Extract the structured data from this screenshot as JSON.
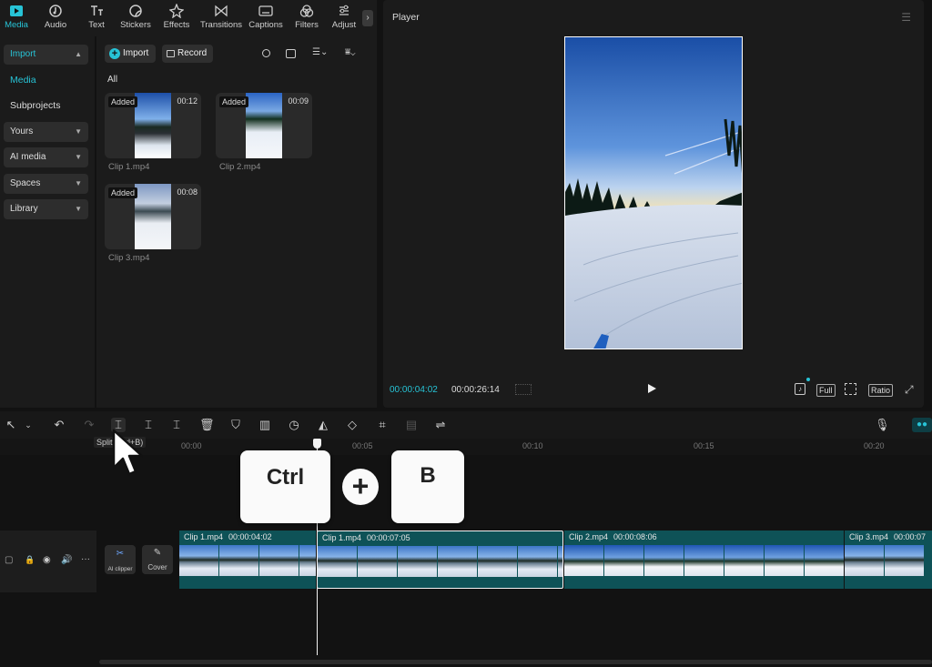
{
  "nav": {
    "tabs": [
      {
        "label": "Media",
        "icon": "media-icon"
      },
      {
        "label": "Audio",
        "icon": "audio-icon"
      },
      {
        "label": "Text",
        "icon": "text-icon"
      },
      {
        "label": "Stickers",
        "icon": "stickers-icon"
      },
      {
        "label": "Effects",
        "icon": "effects-icon"
      },
      {
        "label": "Transitions",
        "icon": "transitions-icon"
      },
      {
        "label": "Captions",
        "icon": "captions-icon"
      },
      {
        "label": "Filters",
        "icon": "filters-icon"
      },
      {
        "label": "Adjust",
        "icon": "adjust-icon"
      }
    ],
    "active": "Media"
  },
  "sidebar": {
    "import_label": "Import",
    "media_label": "Media",
    "subprojects_label": "Subprojects",
    "yours_label": "Yours",
    "ai_media_label": "AI media",
    "spaces_label": "Spaces",
    "library_label": "Library"
  },
  "media": {
    "import_button": "Import",
    "record_button": "Record",
    "filter_label": "All",
    "clips": [
      {
        "name": "Clip 1.mp4",
        "duration": "00:12",
        "badge": "Added"
      },
      {
        "name": "Clip 2.mp4",
        "duration": "00:09",
        "badge": "Added"
      },
      {
        "name": "Clip 3.mp4",
        "duration": "00:08",
        "badge": "Added"
      }
    ]
  },
  "player": {
    "title": "Player",
    "current_time": "00:00:04:02",
    "total_time": "00:00:26:14",
    "full_label": "Full",
    "ratio_label": "Ratio"
  },
  "toolbar": {
    "tooltip": "Split (Ctrl+B)"
  },
  "ruler": {
    "ticks": [
      "00:00",
      "00:05",
      "00:10",
      "00:15",
      "00:20"
    ]
  },
  "keys": {
    "ctrl": "Ctrl",
    "plus": "+",
    "b": "B"
  },
  "track": {
    "ai_clipper_label": "AI clipper",
    "cover_label": "Cover",
    "clips": [
      {
        "name": "Clip 1.mp4",
        "time": "00:00:04:02"
      },
      {
        "name": "Clip 1.mp4",
        "time": "00:00:07:05"
      },
      {
        "name": "Clip 2.mp4",
        "time": "00:00:08:06"
      },
      {
        "name": "Clip 3.mp4",
        "time": "00:00:07"
      }
    ]
  },
  "colors": {
    "accent": "#27c3d6",
    "clip_bg": "#0e5257"
  }
}
